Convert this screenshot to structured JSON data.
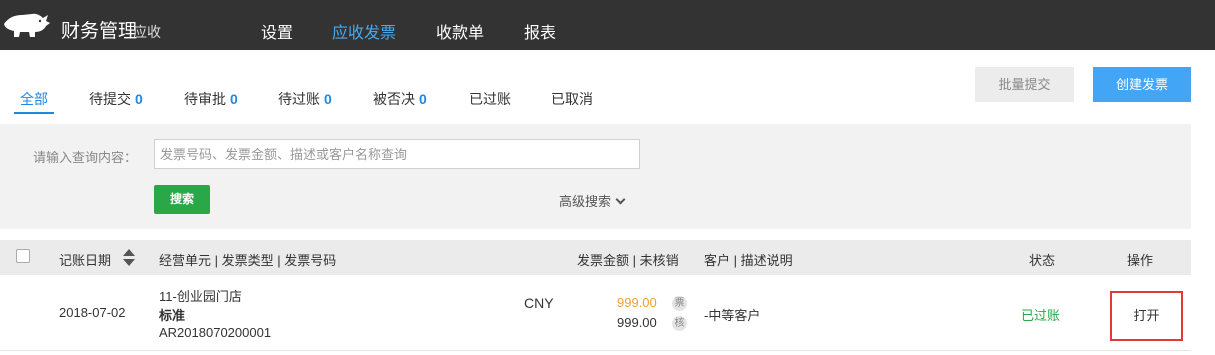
{
  "header": {
    "app_title": "财务管理",
    "app_subtitle": "应收",
    "nav": [
      {
        "label": "设置",
        "active": false
      },
      {
        "label": "应收发票",
        "active": true
      },
      {
        "label": "收款单",
        "active": false
      },
      {
        "label": "报表",
        "active": false
      }
    ],
    "accent_color": "#49a9ee"
  },
  "tabs": [
    {
      "label": "全部",
      "count": null,
      "active": true
    },
    {
      "label": "待提交",
      "count": "0"
    },
    {
      "label": "待审批",
      "count": "0"
    },
    {
      "label": "待过账",
      "count": "0"
    },
    {
      "label": "被否决",
      "count": "0"
    },
    {
      "label": "已过账",
      "count": null
    },
    {
      "label": "已取消",
      "count": null
    }
  ],
  "actions": {
    "batch_submit": "批量提交",
    "create_invoice": "创建发票"
  },
  "search": {
    "label": "请输入查询内容：",
    "placeholder": "发票号码、发票金额、描述或客户名称查询",
    "value": "",
    "search_button": "搜索",
    "advanced_label": "高级搜索"
  },
  "table": {
    "columns": {
      "date": "记账日期",
      "unit": "经营单元 | 发票类型 | 发票号码",
      "amount": "发票金额 | 未核销",
      "customer": "客户 | 描述说明",
      "status": "状态",
      "action": "操作"
    },
    "rows": [
      {
        "date": "2018-07-02",
        "unit": "11-创业园门店",
        "type": "标准",
        "number": "AR2018070200001",
        "currency": "CNY",
        "invoice_amount": "999.00",
        "invoice_badge": "票",
        "unwritten_amount": "999.00",
        "unwritten_badge": "核",
        "customer": "-中等客户",
        "status": "已过账",
        "action": "打开"
      }
    ]
  }
}
